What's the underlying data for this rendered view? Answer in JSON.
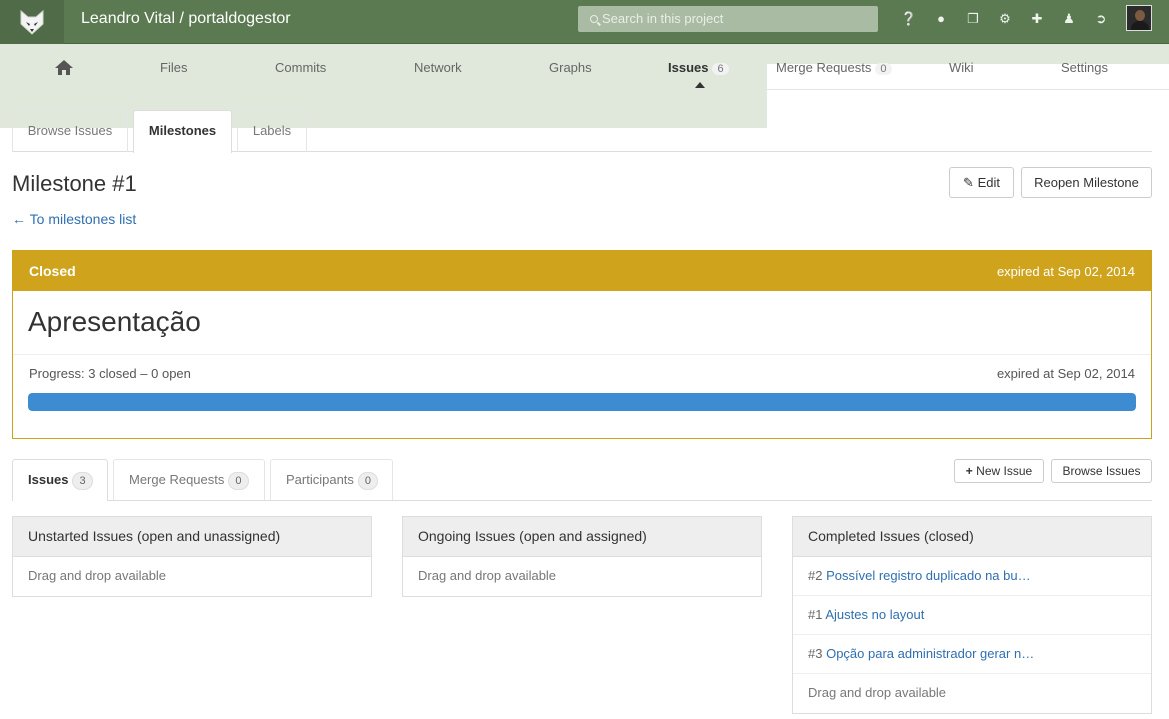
{
  "header": {
    "project_title": "Leandro Vital / portaldogestor",
    "search_placeholder": "Search in this project",
    "icons": [
      "help-icon",
      "globe-icon",
      "copy-icon",
      "cogs-icon",
      "plus-icon",
      "user-icon",
      "sign-out-icon"
    ]
  },
  "nav": {
    "home": "home-icon",
    "items": [
      {
        "label": "Files"
      },
      {
        "label": "Commits"
      },
      {
        "label": "Network"
      },
      {
        "label": "Graphs"
      },
      {
        "label": "Issues",
        "count": "6"
      },
      {
        "label": "Merge Requests",
        "count": "0"
      },
      {
        "label": "Wiki"
      },
      {
        "label": "Settings"
      }
    ]
  },
  "subtabs": [
    "Browse Issues",
    "Milestones",
    "Labels"
  ],
  "page": {
    "title": "Milestone #1",
    "edit_label": "Edit",
    "reopen_label": "Reopen Milestone",
    "back_link": "← To milestones list"
  },
  "milestone": {
    "state": "Closed",
    "expired": "expired at Sep 02, 2014",
    "name": "Apresentação",
    "progress_text": "Progress: 3 closed – 0 open",
    "progress_expired": "expired at Sep 02, 2014",
    "progress_percent": 100
  },
  "bottom_tabs": [
    {
      "label": "Issues",
      "count": "3"
    },
    {
      "label": "Merge Requests",
      "count": "0"
    },
    {
      "label": "Participants",
      "count": "0"
    }
  ],
  "actions": {
    "new_issue": "New Issue",
    "browse_issues": "Browse Issues"
  },
  "panels": {
    "unstarted": {
      "title": "Unstarted Issues (open and unassigned)",
      "drag": "Drag and drop available"
    },
    "ongoing": {
      "title": "Ongoing Issues (open and assigned)",
      "drag": "Drag and drop available"
    },
    "completed": {
      "title": "Completed Issues (closed)",
      "issues": [
        {
          "num": "#2",
          "title": "Possível registro duplicado na bu…"
        },
        {
          "num": "#1",
          "title": "Ajustes no layout"
        },
        {
          "num": "#3",
          "title": "Opção para administrador gerar n…"
        }
      ],
      "drag": "Drag and drop available"
    }
  },
  "colors": {
    "topbar": "#5b7a52",
    "milestone_closed": "#cfa41c",
    "progress": "#3d8bd0",
    "link": "#2f6fb0"
  }
}
